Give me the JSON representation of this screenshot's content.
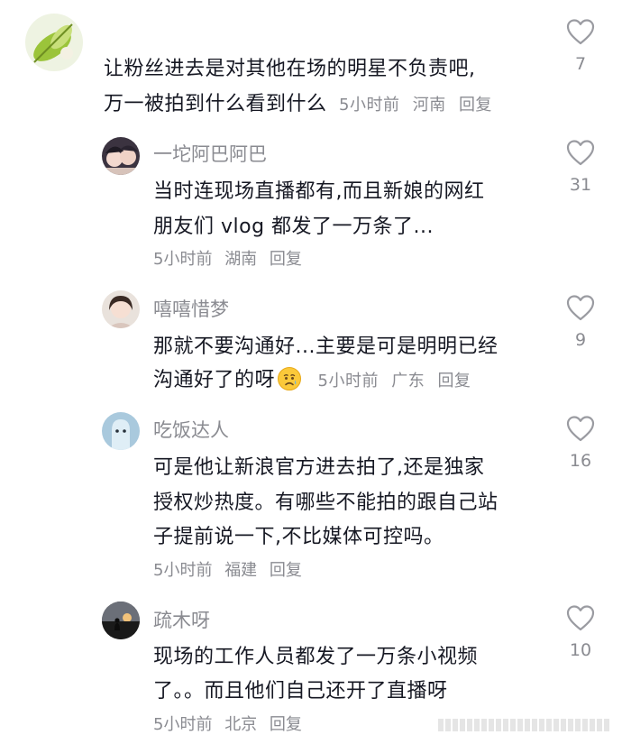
{
  "comments": [
    {
      "username": "",
      "lines": [
        "让粉丝进去是对其他在场的明星不负责吧,",
        "万一被拍到什么看到什么"
      ],
      "time": "5小时前",
      "location": "河南",
      "reply": "回复",
      "likes": "7",
      "avatar_icon": "leaf-photo-avatar",
      "emoji": ""
    },
    {
      "username": "一坨阿巴阿巴",
      "lines": [
        "当时连现场直播都有,而且新娘的网红",
        "朋友们 vlog 都发了一万条了..."
      ],
      "time": "5小时前",
      "location": "湖南",
      "reply": "回复",
      "likes": "31",
      "avatar_icon": "anime-couple-avatar",
      "emoji": ""
    },
    {
      "username": "嘻嘻惜梦",
      "lines": [
        "那就不要沟通好...主要是可是明明已经",
        "沟通好了的呀"
      ],
      "time": "5小时前",
      "location": "广东",
      "reply": "回复",
      "likes": "9",
      "avatar_icon": "girl-portrait-avatar",
      "emoji": "sad-face-emoji"
    },
    {
      "username": "吃饭达人",
      "lines": [
        "可是他让新浪官方进去拍了,还是独家",
        "授权炒热度。有哪些不能拍的跟自己站",
        "子提前说一下,不比媒体可控吗。"
      ],
      "time": "5小时前",
      "location": "福建",
      "reply": "回复",
      "likes": "16",
      "avatar_icon": "ghost-figure-avatar",
      "emoji": ""
    },
    {
      "username": "疏木呀",
      "lines": [
        "现场的工作人员都发了一万条小视频",
        "了。。而且他们自己还开了直播呀"
      ],
      "time": "5小时前",
      "location": "北京",
      "reply": "回复",
      "likes": "10",
      "avatar_icon": "sunset-silhouette-avatar",
      "emoji": ""
    }
  ],
  "colors": {
    "text": "#161823",
    "muted": "#8a8b91",
    "icon": "#9a9ba1"
  }
}
